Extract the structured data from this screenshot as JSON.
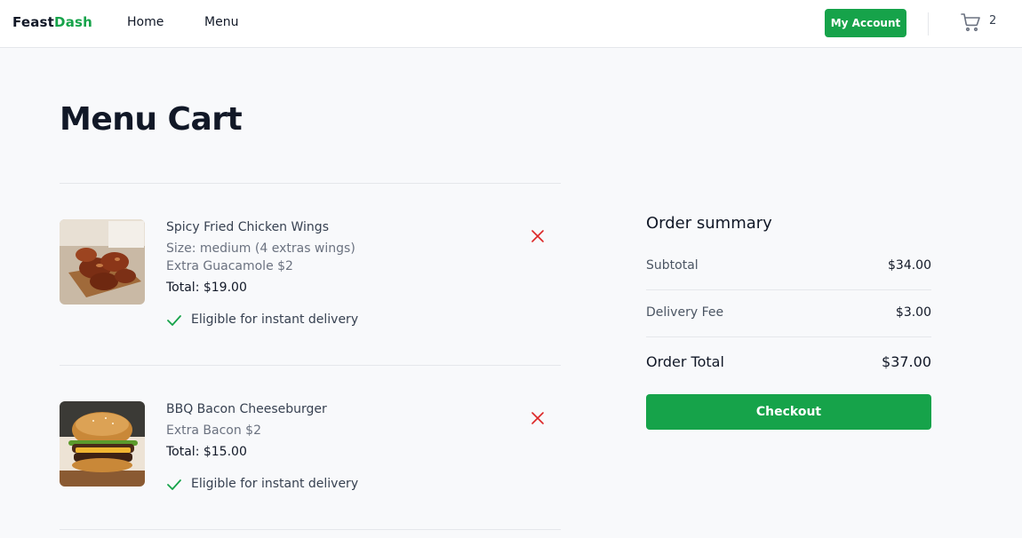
{
  "brand": {
    "part1": "Feast",
    "part2": "Dash"
  },
  "nav": {
    "home": "Home",
    "menu": "Menu"
  },
  "account": {
    "label": "My Account"
  },
  "cart": {
    "count": "2",
    "icon": "cart-icon"
  },
  "page": {
    "title": "Menu Cart"
  },
  "items": [
    {
      "name": "Spicy Fried Chicken Wings",
      "details": [
        "Size: medium (4 extras wings)",
        "Extra Guacamole $2"
      ],
      "total": "Total: $19.00",
      "delivery": "Eligible for instant delivery"
    },
    {
      "name": "BBQ Bacon Cheeseburger",
      "details": [
        "Extra Bacon $2"
      ],
      "total": "Total: $15.00",
      "delivery": "Eligible for instant delivery"
    }
  ],
  "summary": {
    "title": "Order summary",
    "subtotal_label": "Subtotal",
    "subtotal_value": "$34.00",
    "delivery_label": "Delivery Fee",
    "delivery_value": "$3.00",
    "total_label": "Order Total",
    "total_value": "$37.00",
    "checkout_label": "Checkout"
  },
  "colors": {
    "accent": "#16a34a",
    "remove": "#dc2626",
    "text": "#111827"
  }
}
